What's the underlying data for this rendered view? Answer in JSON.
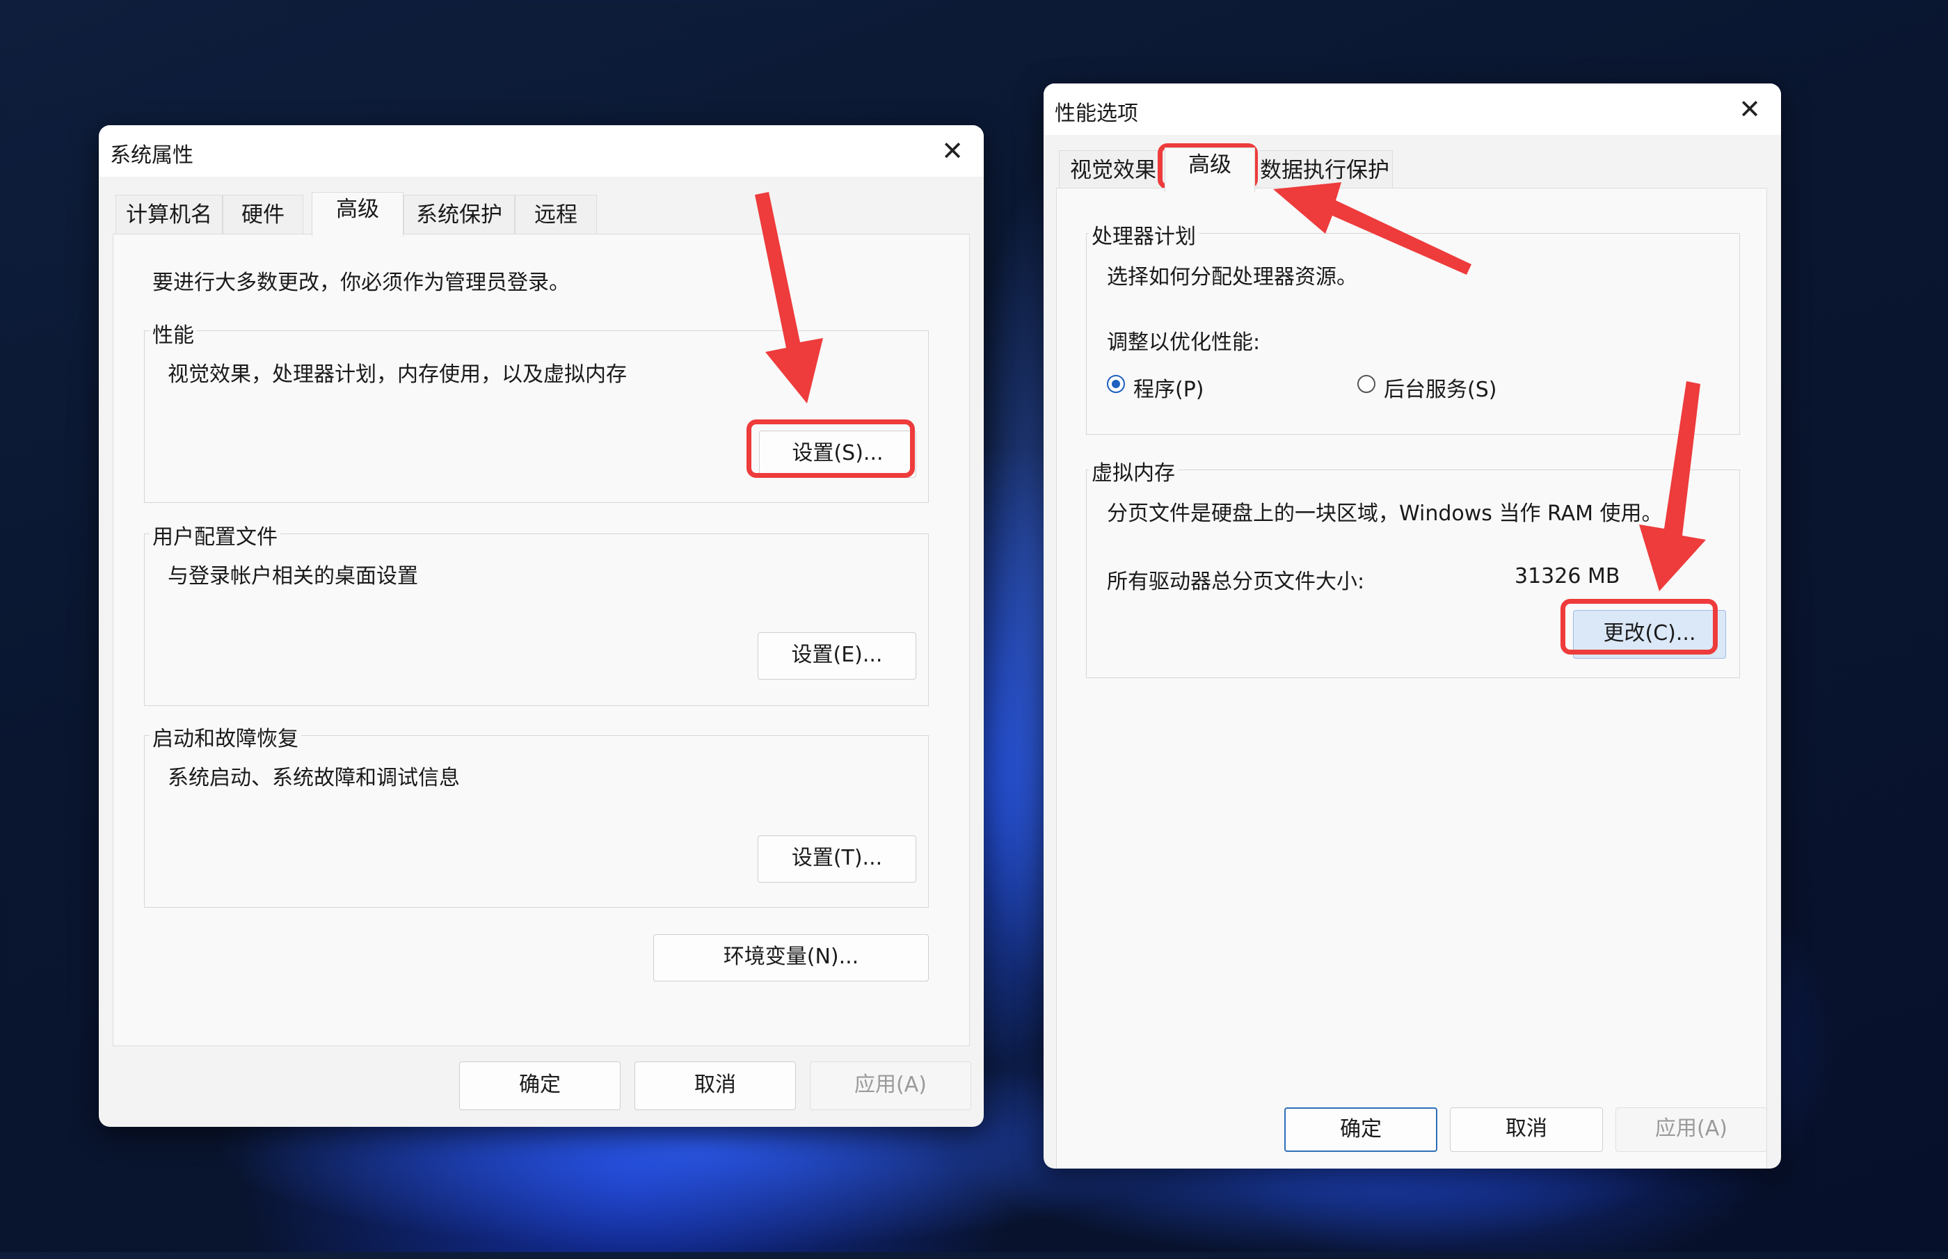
{
  "sys_props": {
    "title": "系统属性",
    "close": "✕",
    "tabs": [
      {
        "label": "计算机名"
      },
      {
        "label": "硬件"
      },
      {
        "label": "高级"
      },
      {
        "label": "系统保护"
      },
      {
        "label": "远程"
      }
    ],
    "admin_note": "要进行大多数更改，你必须作为管理员登录。",
    "performance": {
      "legend": "性能",
      "desc": "视觉效果，处理器计划，内存使用，以及虚拟内存",
      "button": "设置(S)..."
    },
    "user_profiles": {
      "legend": "用户配置文件",
      "desc": "与登录帐户相关的桌面设置",
      "button": "设置(E)..."
    },
    "startup_recovery": {
      "legend": "启动和故障恢复",
      "desc": "系统启动、系统故障和调试信息",
      "button": "设置(T)..."
    },
    "env_button": "环境变量(N)...",
    "ok": "确定",
    "cancel": "取消",
    "apply": "应用(A)"
  },
  "perf_options": {
    "title": "性能选项",
    "close": "✕",
    "tabs": [
      {
        "label": "视觉效果"
      },
      {
        "label": "高级"
      },
      {
        "label": "数据执行保护"
      }
    ],
    "processor": {
      "legend": "处理器计划",
      "desc": "选择如何分配处理器资源。",
      "adjust_label": "调整以优化性能:",
      "option_programs": "程序(P)",
      "option_services": "后台服务(S)",
      "selected": "程序(P)"
    },
    "virtual_memory": {
      "legend": "虚拟内存",
      "desc": "分页文件是硬盘上的一块区域，Windows 当作 RAM 使用。",
      "total_label": "所有驱动器总分页文件大小:",
      "total_value": "31326 MB",
      "change_button": "更改(C)..."
    },
    "ok": "确定",
    "cancel": "取消",
    "apply": "应用(A)"
  },
  "colors": {
    "annotation": "#ee3b3b",
    "radio_accent": "#1f5fbf",
    "primary_border": "#2f6fb8"
  }
}
